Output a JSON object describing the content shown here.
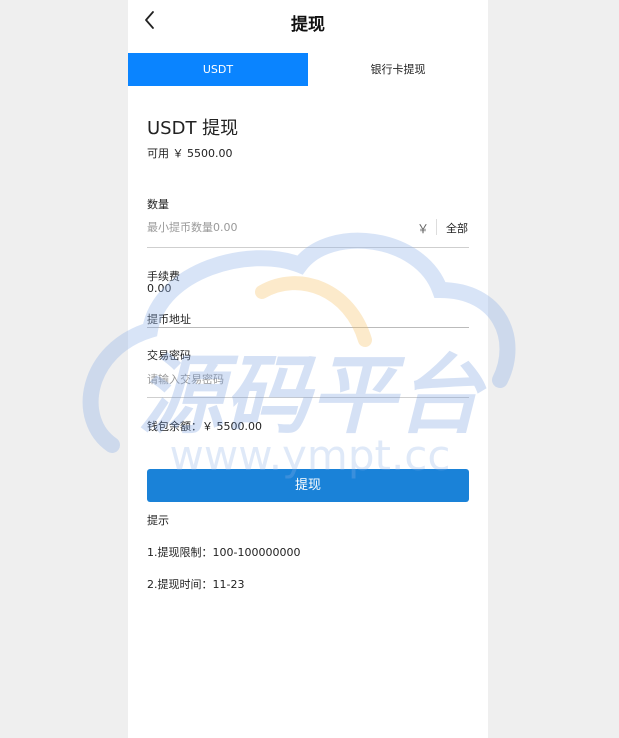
{
  "header": {
    "title": "提现"
  },
  "tabs": [
    {
      "label": "USDT",
      "active": true
    },
    {
      "label": "银行卡提现",
      "active": false
    }
  ],
  "form": {
    "heading": "USDT 提现",
    "available": "可用 ￥ 5500.00",
    "quantity_label": "数量",
    "quantity_placeholder": "最小提币数量0.00",
    "currency_symbol": "￥",
    "all_label": "全部",
    "fee_label": "手续费",
    "fee_value": "0.00",
    "address_placeholder": "提币地址",
    "password_label": "交易密码",
    "password_placeholder": "请输入交易密码",
    "wallet_balance": "钱包余额：￥ 5500.00",
    "submit_label": "提现"
  },
  "tips": {
    "title": "提示",
    "items": [
      "1.提现限制：100-100000000",
      "2.提现时间：11-23"
    ]
  },
  "watermark": {
    "brand": "源码平台",
    "url": "www.ympt.cc"
  },
  "colors": {
    "accent": "#0a84ff",
    "button": "#1a82d8",
    "watermark_blue": "#8fb3e8",
    "watermark_orange": "#f7c26b"
  },
  "icons": {
    "back": "chevron-left-icon"
  }
}
